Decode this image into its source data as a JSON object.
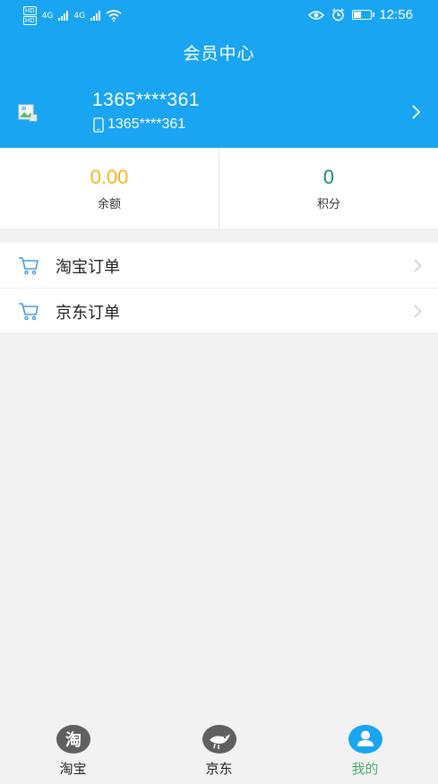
{
  "status_bar": {
    "network_left": "4G",
    "network_right": "4G",
    "time": "12:56",
    "battery_level": 0.45
  },
  "header": {
    "title": "会员中心"
  },
  "profile": {
    "name": "1365****361",
    "phone": "1365****361",
    "avatar_icon": "broken-image-icon",
    "phone_icon": "phone-icon"
  },
  "stats": {
    "balance": {
      "value": "0.00",
      "label": "余额",
      "color": "#f5b51d"
    },
    "points": {
      "value": "0",
      "label": "积分",
      "color": "#1a8a7a"
    }
  },
  "menu": {
    "items": [
      {
        "label": "淘宝订单",
        "icon": "cart-icon"
      },
      {
        "label": "京东订单",
        "icon": "cart-icon"
      }
    ]
  },
  "tabbar": {
    "tabs": [
      {
        "label": "淘宝",
        "icon": "taobao-icon",
        "active": false
      },
      {
        "label": "京东",
        "icon": "jd-icon",
        "active": false
      },
      {
        "label": "我的",
        "icon": "user-icon",
        "active": true
      }
    ]
  },
  "colors": {
    "header_bg": "#1aa5f2",
    "active_tab": "#4cae6c",
    "active_icon": "#1aa5f2"
  }
}
